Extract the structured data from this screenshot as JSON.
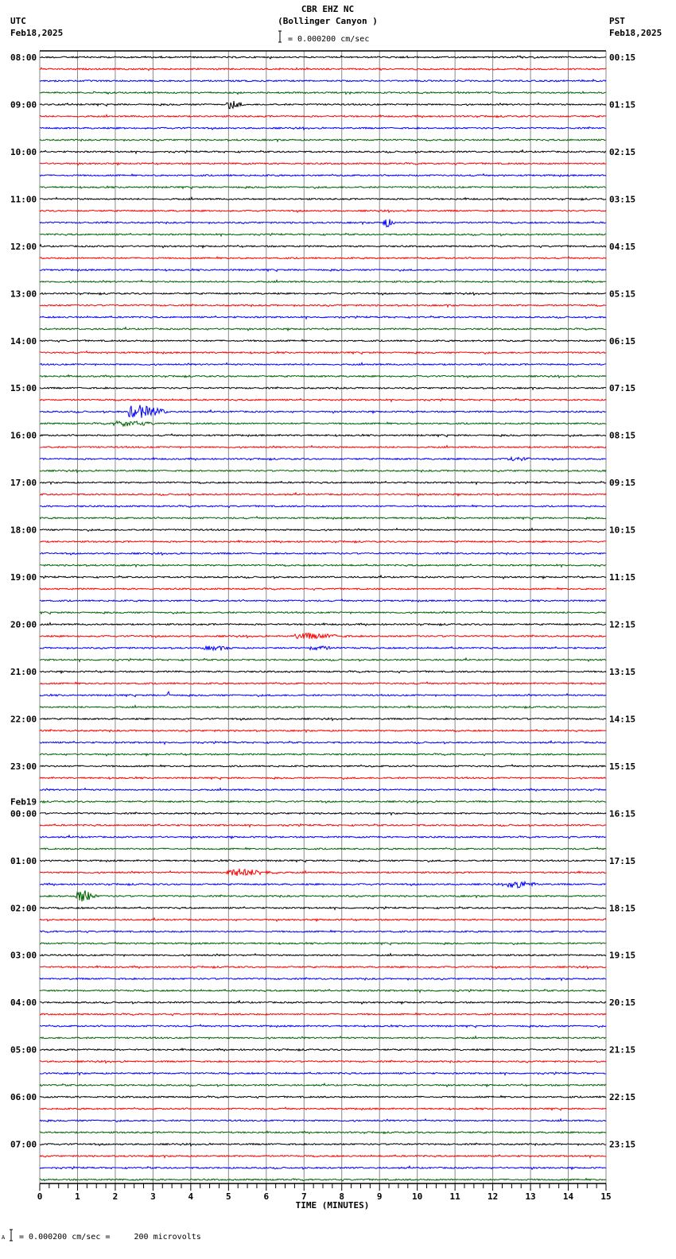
{
  "header": {
    "title": "CBR EHZ NC",
    "subtitle": "(Bollinger Canyon )",
    "scale_text": "= 0.000200 cm/sec",
    "left_tz": "UTC",
    "left_date": "Feb18,2025",
    "right_tz": "PST",
    "right_date": "Feb18,2025"
  },
  "footer": {
    "scale_text": "= 0.000200 cm/sec =     200 microvolts",
    "mark": "A"
  },
  "colors": [
    "#000000",
    "#ff0000",
    "#0000ff",
    "#006400"
  ],
  "chart_data": {
    "type": "line",
    "title": "CBR EHZ NC (Bollinger Canyon )",
    "xlabel": "TIME (MINUTES)",
    "xlim": [
      0,
      15
    ],
    "x_ticks": [
      "0",
      "1",
      "2",
      "3",
      "4",
      "5",
      "6",
      "7",
      "8",
      "9",
      "10",
      "11",
      "12",
      "13",
      "14",
      "15"
    ],
    "traces_per_hour": 4,
    "left_labels": [
      "08:00",
      "09:00",
      "10:00",
      "11:00",
      "12:00",
      "13:00",
      "14:00",
      "15:00",
      "16:00",
      "17:00",
      "18:00",
      "19:00",
      "20:00",
      "21:00",
      "22:00",
      "23:00",
      "00:00",
      "01:00",
      "02:00",
      "03:00",
      "04:00",
      "05:00",
      "06:00",
      "07:00"
    ],
    "date_change_label": "Feb19",
    "date_change_index": 16,
    "right_labels": [
      "00:15",
      "01:15",
      "02:15",
      "03:15",
      "04:15",
      "05:15",
      "06:15",
      "07:15",
      "08:15",
      "09:15",
      "10:15",
      "11:15",
      "12:15",
      "13:15",
      "14:15",
      "15:15",
      "16:15",
      "17:15",
      "18:15",
      "19:15",
      "20:15",
      "21:15",
      "22:15",
      "23:15"
    ],
    "events": [
      {
        "trace": 4,
        "minute": 5.0,
        "duration": 0.4,
        "amplitude": 6
      },
      {
        "trace": 14,
        "minute": 9.1,
        "duration": 0.3,
        "amplitude": 7
      },
      {
        "trace": 30,
        "minute": 2.4,
        "duration": 1.0,
        "amplitude": 9
      },
      {
        "trace": 31,
        "minute": 2.0,
        "duration": 1.2,
        "amplitude": 4
      },
      {
        "trace": 34,
        "minute": 12.4,
        "duration": 0.8,
        "amplitude": 3
      },
      {
        "trace": 49,
        "minute": 6.8,
        "duration": 1.5,
        "amplitude": 4
      },
      {
        "trace": 50,
        "minute": 4.4,
        "duration": 0.9,
        "amplitude": 3
      },
      {
        "trace": 50,
        "minute": 7.2,
        "duration": 0.8,
        "amplitude": 3
      },
      {
        "trace": 54,
        "minute": 3.4,
        "duration": 0.05,
        "amplitude": 6
      },
      {
        "trace": 69,
        "minute": 5.0,
        "duration": 1.5,
        "amplitude": 5
      },
      {
        "trace": 70,
        "minute": 12.4,
        "duration": 0.9,
        "amplitude": 5
      },
      {
        "trace": 71,
        "minute": 1.0,
        "duration": 0.5,
        "amplitude": 9
      }
    ]
  }
}
